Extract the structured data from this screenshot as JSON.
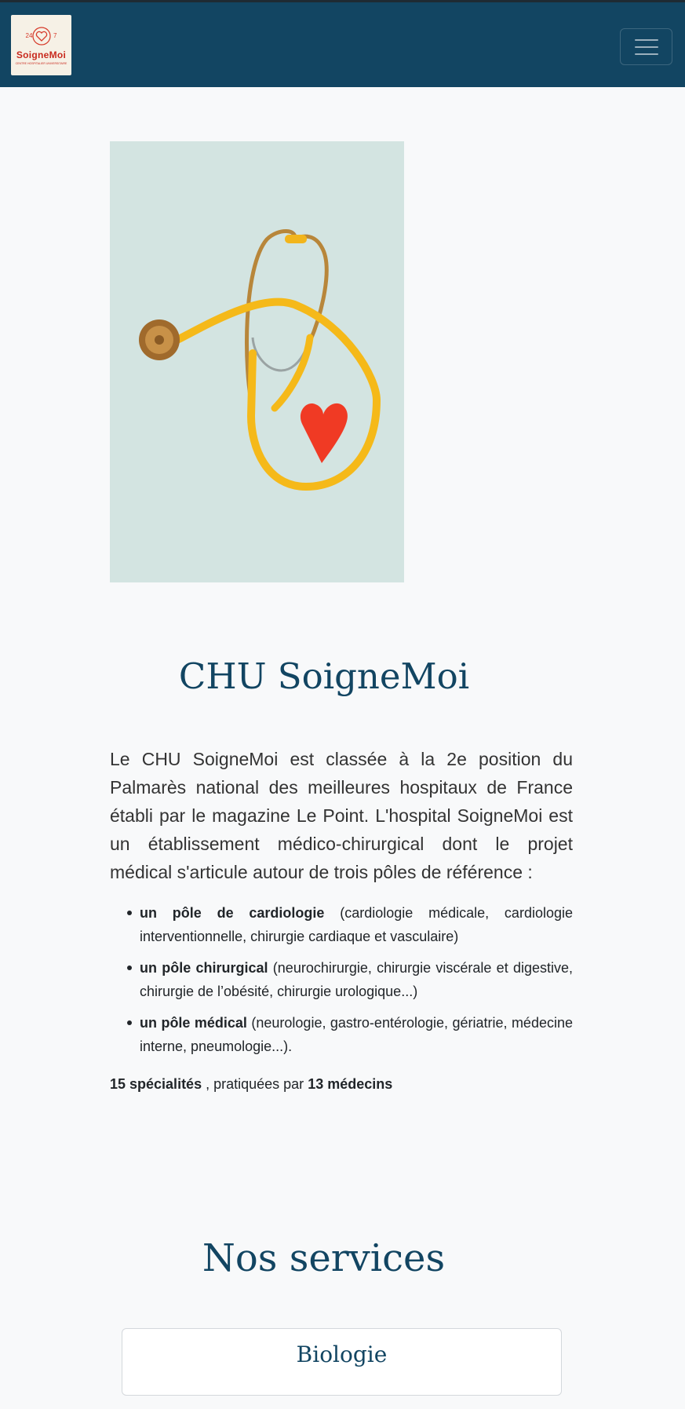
{
  "navbar": {
    "logo": {
      "name": "SoigneMoi",
      "badge_left": "24",
      "badge_right": "7",
      "tagline": "CENTRE HOSPITALIER UNIVERSITAIRE"
    },
    "menu_icon": "hamburger-icon"
  },
  "hero": {
    "image_subject": "stethoscope with red paper heart"
  },
  "about": {
    "title": "CHU SoigneMoi",
    "intro": "Le CHU SoigneMoi est classée à la 2e position du Palmarès national des meilleures hospitaux de France établi par le magazine Le Point. L'hospital SoigneMoi est un établissement médico-chirurgical dont le projet médical s'articule autour de trois pôles de référence :",
    "poles": [
      {
        "name": "un pôle de cardiologie",
        "detail": " (cardiologie médicale, cardiologie interventionnelle, chirurgie cardiaque et vasculaire)"
      },
      {
        "name": "un pôle chirurgical",
        "detail": " (neurochirurgie, chirurgie viscérale et digestive, chirurgie de l’obésité, chirurgie urologique...)"
      },
      {
        "name": "un pôle médical",
        "detail": " (neurologie, gastro-entérologie, gériatrie, médecine interne, pneumologie...)."
      }
    ],
    "stats": {
      "specialties": "15 spécialités",
      "middle": " , pratiquées par ",
      "doctors": "13 médecins"
    }
  },
  "services": {
    "title": "Nos services",
    "items": [
      {
        "label": "Biologie"
      }
    ]
  },
  "colors": {
    "brand": "#124562",
    "logo_red": "#c8291d",
    "background": "#f8f9fa"
  }
}
